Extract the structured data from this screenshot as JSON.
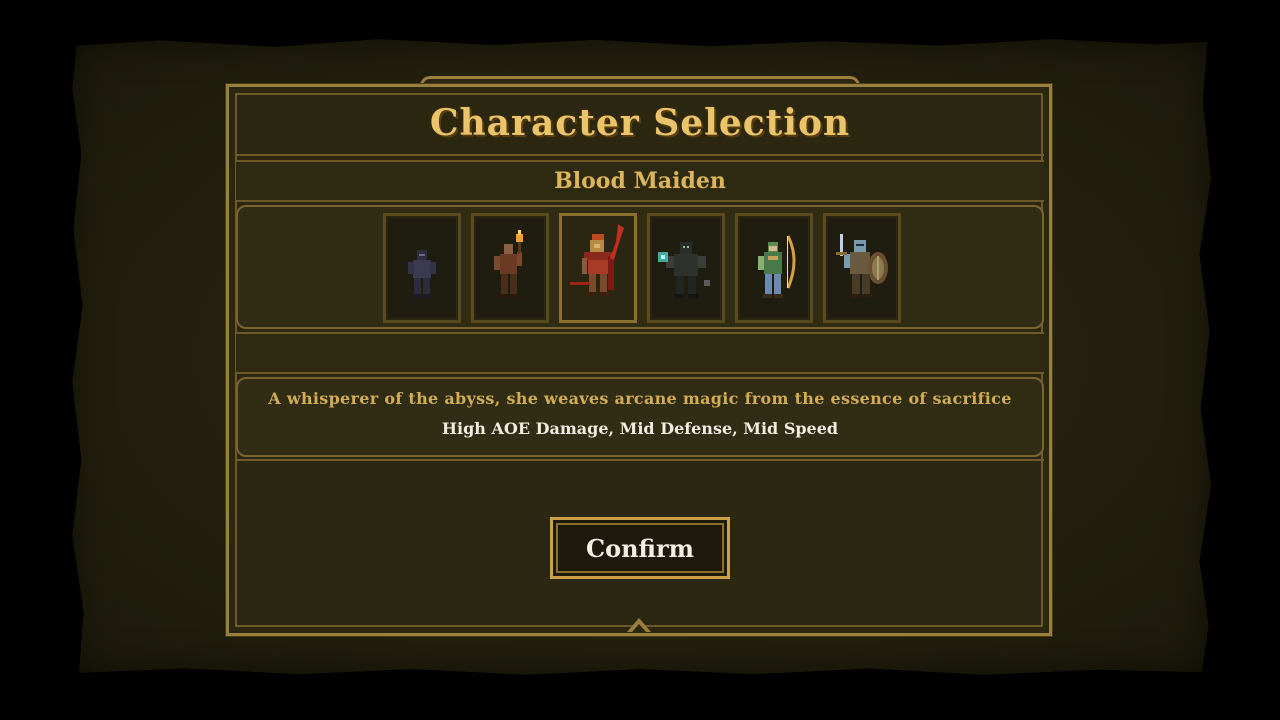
{
  "screen": {
    "title": "Character Selection",
    "selected_name": "Blood Maiden"
  },
  "characters": [
    {
      "name": "shadow-rogue",
      "selected": false,
      "accent": "#4a4a66"
    },
    {
      "name": "torch-bearer",
      "selected": false,
      "accent": "#7a4a30"
    },
    {
      "name": "blood-maiden",
      "selected": true,
      "accent": "#b33a2a"
    },
    {
      "name": "dark-mage",
      "selected": false,
      "accent": "#4ad0c0"
    },
    {
      "name": "archer",
      "selected": false,
      "accent": "#8ab070"
    },
    {
      "name": "shield-knight",
      "selected": false,
      "accent": "#5a7a90"
    }
  ],
  "description": {
    "flavor": "A whisperer of the abyss, she weaves arcane magic from the essence of sacrifice",
    "stats": "High AOE Damage, Mid Defense, Mid Speed"
  },
  "actions": {
    "confirm_label": "Confirm"
  },
  "colors": {
    "gold": "#e9c46a",
    "frame": "#9b7f3c",
    "panel": "#2b2711"
  }
}
